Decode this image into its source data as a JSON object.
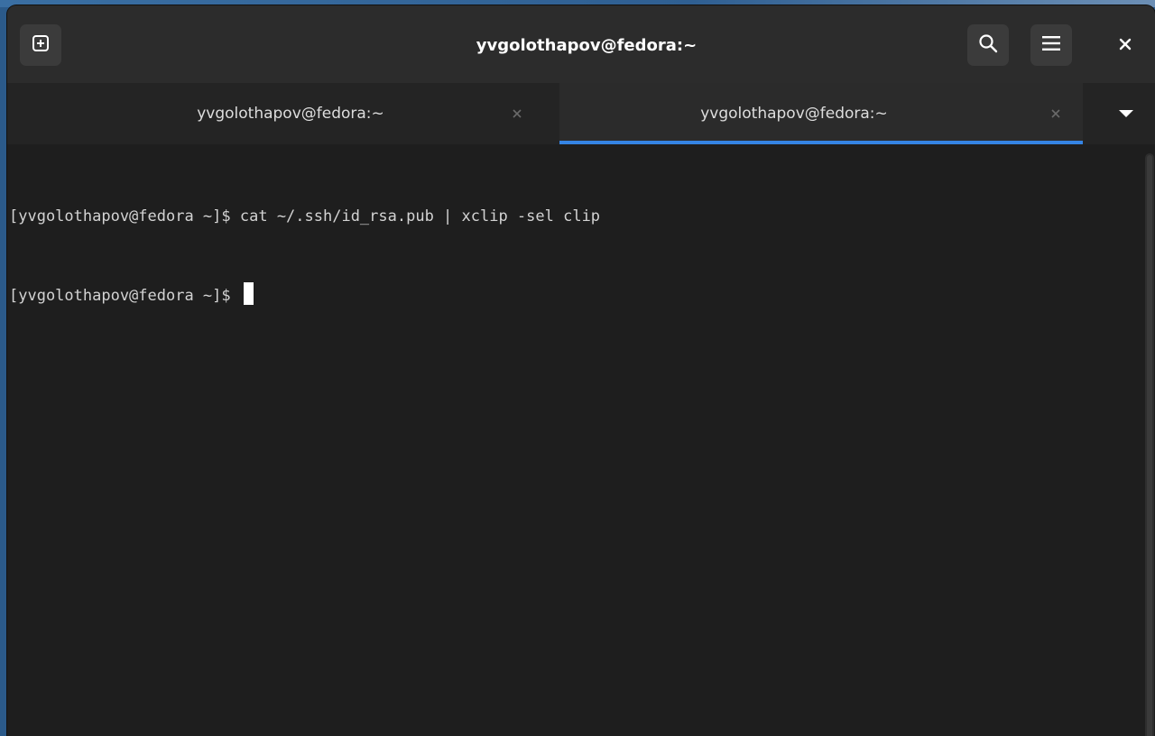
{
  "window": {
    "title": "yvgolothapov@fedora:~"
  },
  "header": {
    "new_tab_icon": "new-tab-icon",
    "search_icon": "search-icon",
    "menu_icon": "hamburger-menu-icon",
    "close_icon": "close-icon"
  },
  "tabs": [
    {
      "label": "yvgolothapov@fedora:~",
      "active": false
    },
    {
      "label": "yvgolothapov@fedora:~",
      "active": true
    }
  ],
  "terminal": {
    "lines": [
      {
        "prompt": "[yvgolothapov@fedora ~]$ ",
        "command": "cat ~/.ssh/id_rsa.pub | xclip -sel clip"
      },
      {
        "prompt": "[yvgolothapov@fedora ~]$ ",
        "command": ""
      }
    ]
  },
  "colors": {
    "accent": "#3584e4",
    "headerbar": "#2c2c2c",
    "terminal_bg": "#1e1e1e",
    "terminal_fg": "#d3d3d3"
  }
}
